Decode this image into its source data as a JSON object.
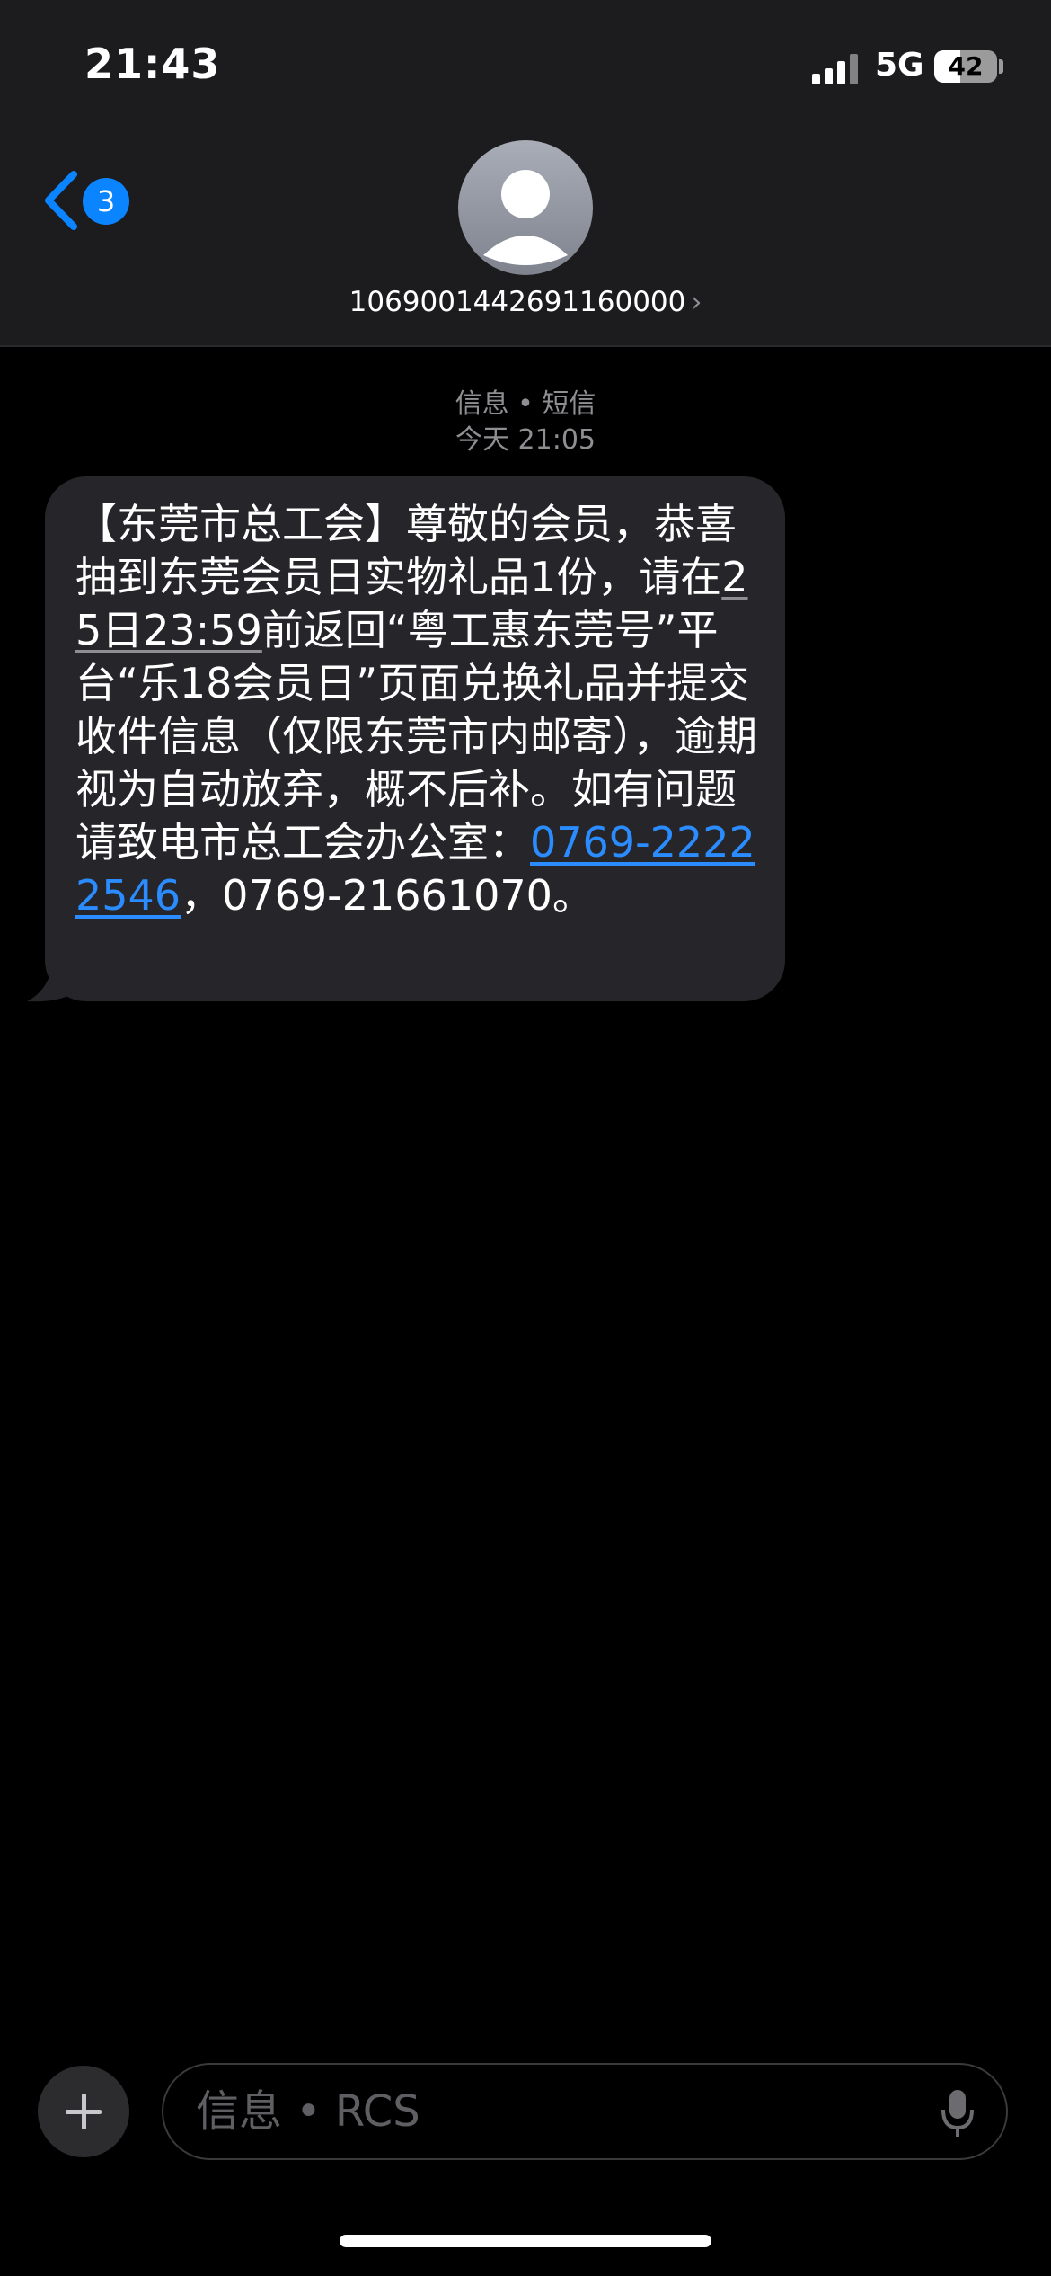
{
  "status_bar": {
    "time": "21:43",
    "network": "5G",
    "battery_level": "42"
  },
  "nav": {
    "back_badge_count": "3",
    "contact_name": "1069001442691160000",
    "contact_chevron": "›"
  },
  "thread": {
    "service_label": "信息 • 短信",
    "timestamp": "今天 21:05",
    "message": {
      "part1": "【东莞市总工会】尊敬的会员，恭喜抽到东莞会员日实物礼品1份，请在",
      "date_link": "25日23:59",
      "part2": "前返回“粤工惠东莞号”平台“乐18会员日”页面兑换礼品并提交收件信息（仅限东莞市内邮寄），逾期视为自动放弃，概不后补。如有问题请致电市总工会办公室：",
      "phone_link": "0769-22222546",
      "part3": "，0769-21661070。"
    }
  },
  "composer": {
    "placeholder": "信息 • RCS"
  },
  "colors": {
    "accent": "#0a84ff",
    "link": "#2a8cff",
    "bubble": "#26262a",
    "header": "#1c1c1e"
  },
  "icons": {
    "back": "chevron-left-icon",
    "avatar": "person-icon",
    "plus": "plus-icon",
    "mic": "microphone-icon"
  }
}
